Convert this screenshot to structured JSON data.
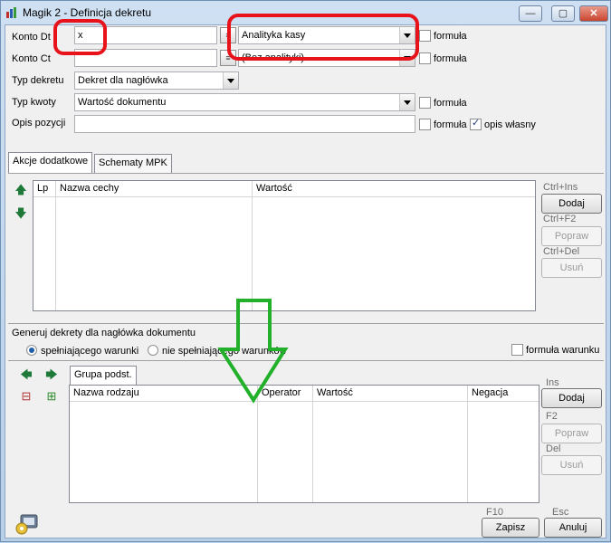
{
  "window": {
    "title": "Magik 2 - Definicja dekretu"
  },
  "caption_buttons": {
    "minimize": "—",
    "maximize": "▢",
    "close": "✕"
  },
  "fields": {
    "konto_dt": {
      "label": "Konto Dt",
      "value": "x",
      "analytics": "Analityka kasy",
      "formula": "formuła"
    },
    "konto_ct": {
      "label": "Konto Ct",
      "value": "",
      "analytics": "(Bez analityki)",
      "formula": "formuła"
    },
    "typ_dekretu": {
      "label": "Typ dekretu",
      "value": "Dekret dla nagłówka"
    },
    "typ_kwoty": {
      "label": "Typ kwoty",
      "value": "Wartość dokumentu",
      "formula": "formuła"
    },
    "opis_pozycji": {
      "label": "Opis pozycji",
      "value": "",
      "formula": "formuła",
      "own_desc": "opis własny",
      "own_desc_checked": true
    }
  },
  "tabs": [
    {
      "label": "Akcje dodatkowe",
      "active": true
    },
    {
      "label": "Schematy MPK",
      "active": false
    }
  ],
  "grid1": {
    "columns": [
      "Lp",
      "Nazwa cechy",
      "Wartość"
    ],
    "actions": [
      {
        "hotkey": "Ctrl+Ins",
        "label": "Dodaj",
        "enabled": true
      },
      {
        "hotkey": "Ctrl+F2",
        "label": "Popraw",
        "enabled": false
      },
      {
        "hotkey": "Ctrl+Del",
        "label": "Usuń",
        "enabled": false
      }
    ]
  },
  "generate": {
    "title": "Generuj dekrety dla nagłówka dokumentu",
    "radio1": "spełniającego warunki",
    "radio2": "nie spełniającego warunków",
    "condition_formula": "formuła warunku"
  },
  "group_tab": "Grupa podst.",
  "grid2": {
    "columns": [
      "Nazwa rodzaju",
      "Operator",
      "Wartość",
      "Negacja"
    ],
    "actions": [
      {
        "hotkey": "Ins",
        "label": "Dodaj",
        "enabled": true
      },
      {
        "hotkey": "F2",
        "label": "Popraw",
        "enabled": false
      },
      {
        "hotkey": "Del",
        "label": "Usuń",
        "enabled": false
      }
    ]
  },
  "footer": {
    "save": {
      "hotkey": "F10",
      "label": "Zapisz"
    },
    "cancel": {
      "hotkey": "Esc",
      "label": "Anuluj"
    }
  },
  "colors": {
    "annotation_red": "#e8121a",
    "annotation_green": "#22b02a"
  }
}
